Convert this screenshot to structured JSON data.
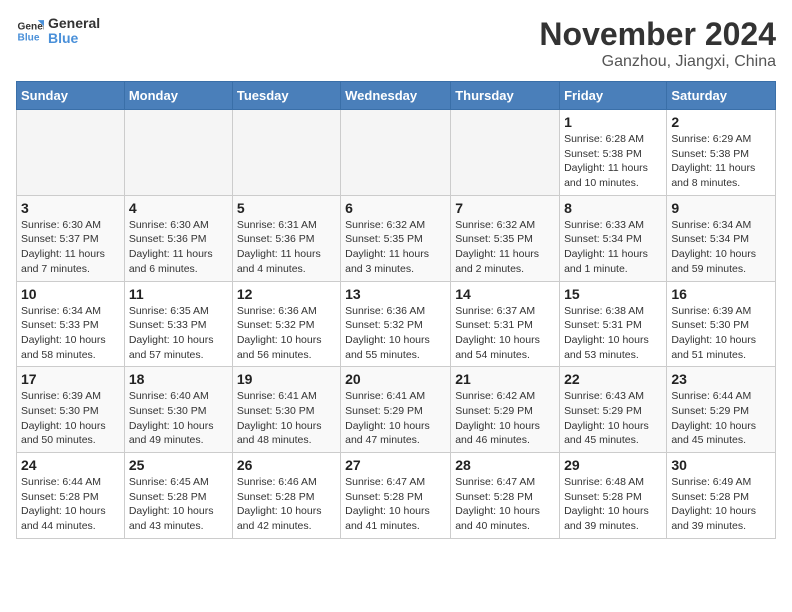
{
  "logo": {
    "line1": "General",
    "line2": "Blue"
  },
  "title": "November 2024",
  "location": "Ganzhou, Jiangxi, China",
  "weekdays": [
    "Sunday",
    "Monday",
    "Tuesday",
    "Wednesday",
    "Thursday",
    "Friday",
    "Saturday"
  ],
  "weeks": [
    [
      {
        "day": "",
        "info": ""
      },
      {
        "day": "",
        "info": ""
      },
      {
        "day": "",
        "info": ""
      },
      {
        "day": "",
        "info": ""
      },
      {
        "day": "",
        "info": ""
      },
      {
        "day": "1",
        "info": "Sunrise: 6:28 AM\nSunset: 5:38 PM\nDaylight: 11 hours and 10 minutes."
      },
      {
        "day": "2",
        "info": "Sunrise: 6:29 AM\nSunset: 5:38 PM\nDaylight: 11 hours and 8 minutes."
      }
    ],
    [
      {
        "day": "3",
        "info": "Sunrise: 6:30 AM\nSunset: 5:37 PM\nDaylight: 11 hours and 7 minutes."
      },
      {
        "day": "4",
        "info": "Sunrise: 6:30 AM\nSunset: 5:36 PM\nDaylight: 11 hours and 6 minutes."
      },
      {
        "day": "5",
        "info": "Sunrise: 6:31 AM\nSunset: 5:36 PM\nDaylight: 11 hours and 4 minutes."
      },
      {
        "day": "6",
        "info": "Sunrise: 6:32 AM\nSunset: 5:35 PM\nDaylight: 11 hours and 3 minutes."
      },
      {
        "day": "7",
        "info": "Sunrise: 6:32 AM\nSunset: 5:35 PM\nDaylight: 11 hours and 2 minutes."
      },
      {
        "day": "8",
        "info": "Sunrise: 6:33 AM\nSunset: 5:34 PM\nDaylight: 11 hours and 1 minute."
      },
      {
        "day": "9",
        "info": "Sunrise: 6:34 AM\nSunset: 5:34 PM\nDaylight: 10 hours and 59 minutes."
      }
    ],
    [
      {
        "day": "10",
        "info": "Sunrise: 6:34 AM\nSunset: 5:33 PM\nDaylight: 10 hours and 58 minutes."
      },
      {
        "day": "11",
        "info": "Sunrise: 6:35 AM\nSunset: 5:33 PM\nDaylight: 10 hours and 57 minutes."
      },
      {
        "day": "12",
        "info": "Sunrise: 6:36 AM\nSunset: 5:32 PM\nDaylight: 10 hours and 56 minutes."
      },
      {
        "day": "13",
        "info": "Sunrise: 6:36 AM\nSunset: 5:32 PM\nDaylight: 10 hours and 55 minutes."
      },
      {
        "day": "14",
        "info": "Sunrise: 6:37 AM\nSunset: 5:31 PM\nDaylight: 10 hours and 54 minutes."
      },
      {
        "day": "15",
        "info": "Sunrise: 6:38 AM\nSunset: 5:31 PM\nDaylight: 10 hours and 53 minutes."
      },
      {
        "day": "16",
        "info": "Sunrise: 6:39 AM\nSunset: 5:30 PM\nDaylight: 10 hours and 51 minutes."
      }
    ],
    [
      {
        "day": "17",
        "info": "Sunrise: 6:39 AM\nSunset: 5:30 PM\nDaylight: 10 hours and 50 minutes."
      },
      {
        "day": "18",
        "info": "Sunrise: 6:40 AM\nSunset: 5:30 PM\nDaylight: 10 hours and 49 minutes."
      },
      {
        "day": "19",
        "info": "Sunrise: 6:41 AM\nSunset: 5:30 PM\nDaylight: 10 hours and 48 minutes."
      },
      {
        "day": "20",
        "info": "Sunrise: 6:41 AM\nSunset: 5:29 PM\nDaylight: 10 hours and 47 minutes."
      },
      {
        "day": "21",
        "info": "Sunrise: 6:42 AM\nSunset: 5:29 PM\nDaylight: 10 hours and 46 minutes."
      },
      {
        "day": "22",
        "info": "Sunrise: 6:43 AM\nSunset: 5:29 PM\nDaylight: 10 hours and 45 minutes."
      },
      {
        "day": "23",
        "info": "Sunrise: 6:44 AM\nSunset: 5:29 PM\nDaylight: 10 hours and 45 minutes."
      }
    ],
    [
      {
        "day": "24",
        "info": "Sunrise: 6:44 AM\nSunset: 5:28 PM\nDaylight: 10 hours and 44 minutes."
      },
      {
        "day": "25",
        "info": "Sunrise: 6:45 AM\nSunset: 5:28 PM\nDaylight: 10 hours and 43 minutes."
      },
      {
        "day": "26",
        "info": "Sunrise: 6:46 AM\nSunset: 5:28 PM\nDaylight: 10 hours and 42 minutes."
      },
      {
        "day": "27",
        "info": "Sunrise: 6:47 AM\nSunset: 5:28 PM\nDaylight: 10 hours and 41 minutes."
      },
      {
        "day": "28",
        "info": "Sunrise: 6:47 AM\nSunset: 5:28 PM\nDaylight: 10 hours and 40 minutes."
      },
      {
        "day": "29",
        "info": "Sunrise: 6:48 AM\nSunset: 5:28 PM\nDaylight: 10 hours and 39 minutes."
      },
      {
        "day": "30",
        "info": "Sunrise: 6:49 AM\nSunset: 5:28 PM\nDaylight: 10 hours and 39 minutes."
      }
    ]
  ]
}
